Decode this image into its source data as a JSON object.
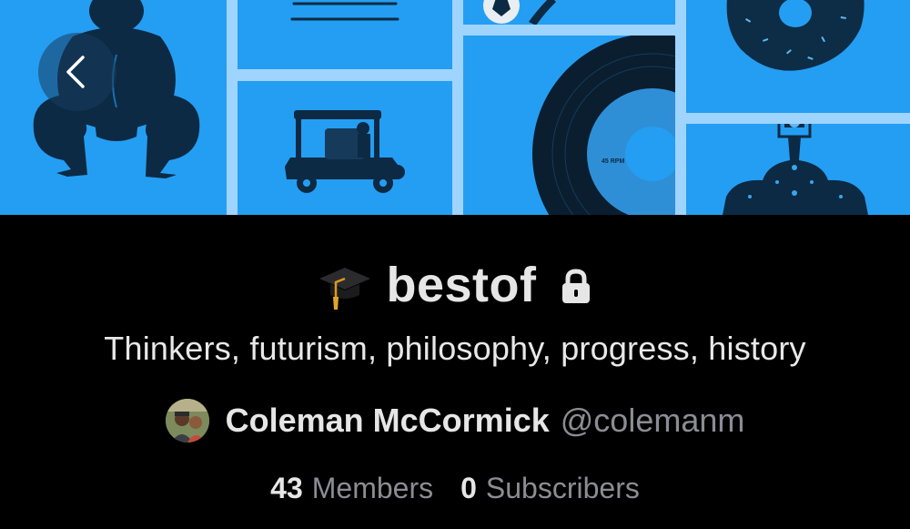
{
  "header": {
    "back_icon": "chevron-left-icon",
    "banner_images": [
      "sumo-wrestler",
      "striped-lines",
      "tuk-tuk",
      "soccer-ball",
      "vinyl-record",
      "donut",
      "crown"
    ],
    "record_label_text": "45 RPM"
  },
  "community": {
    "emoji_icon": "graduation-cap-icon",
    "name": "bestof",
    "lock_icon": "lock-icon",
    "description": "Thinkers, futurism, philosophy, progress, history"
  },
  "owner": {
    "name": "Coleman McCormick",
    "handle": "@colemanm"
  },
  "stats": {
    "members_count": "43",
    "members_label": "Members",
    "subscribers_count": "0",
    "subscribers_label": "Subscribers"
  },
  "colors": {
    "banner_blue": "#249ef2",
    "banner_gap": "#9fd4ff",
    "background": "#000000",
    "primary_text": "#e6e6e6",
    "secondary_text": "#8c8c94"
  }
}
